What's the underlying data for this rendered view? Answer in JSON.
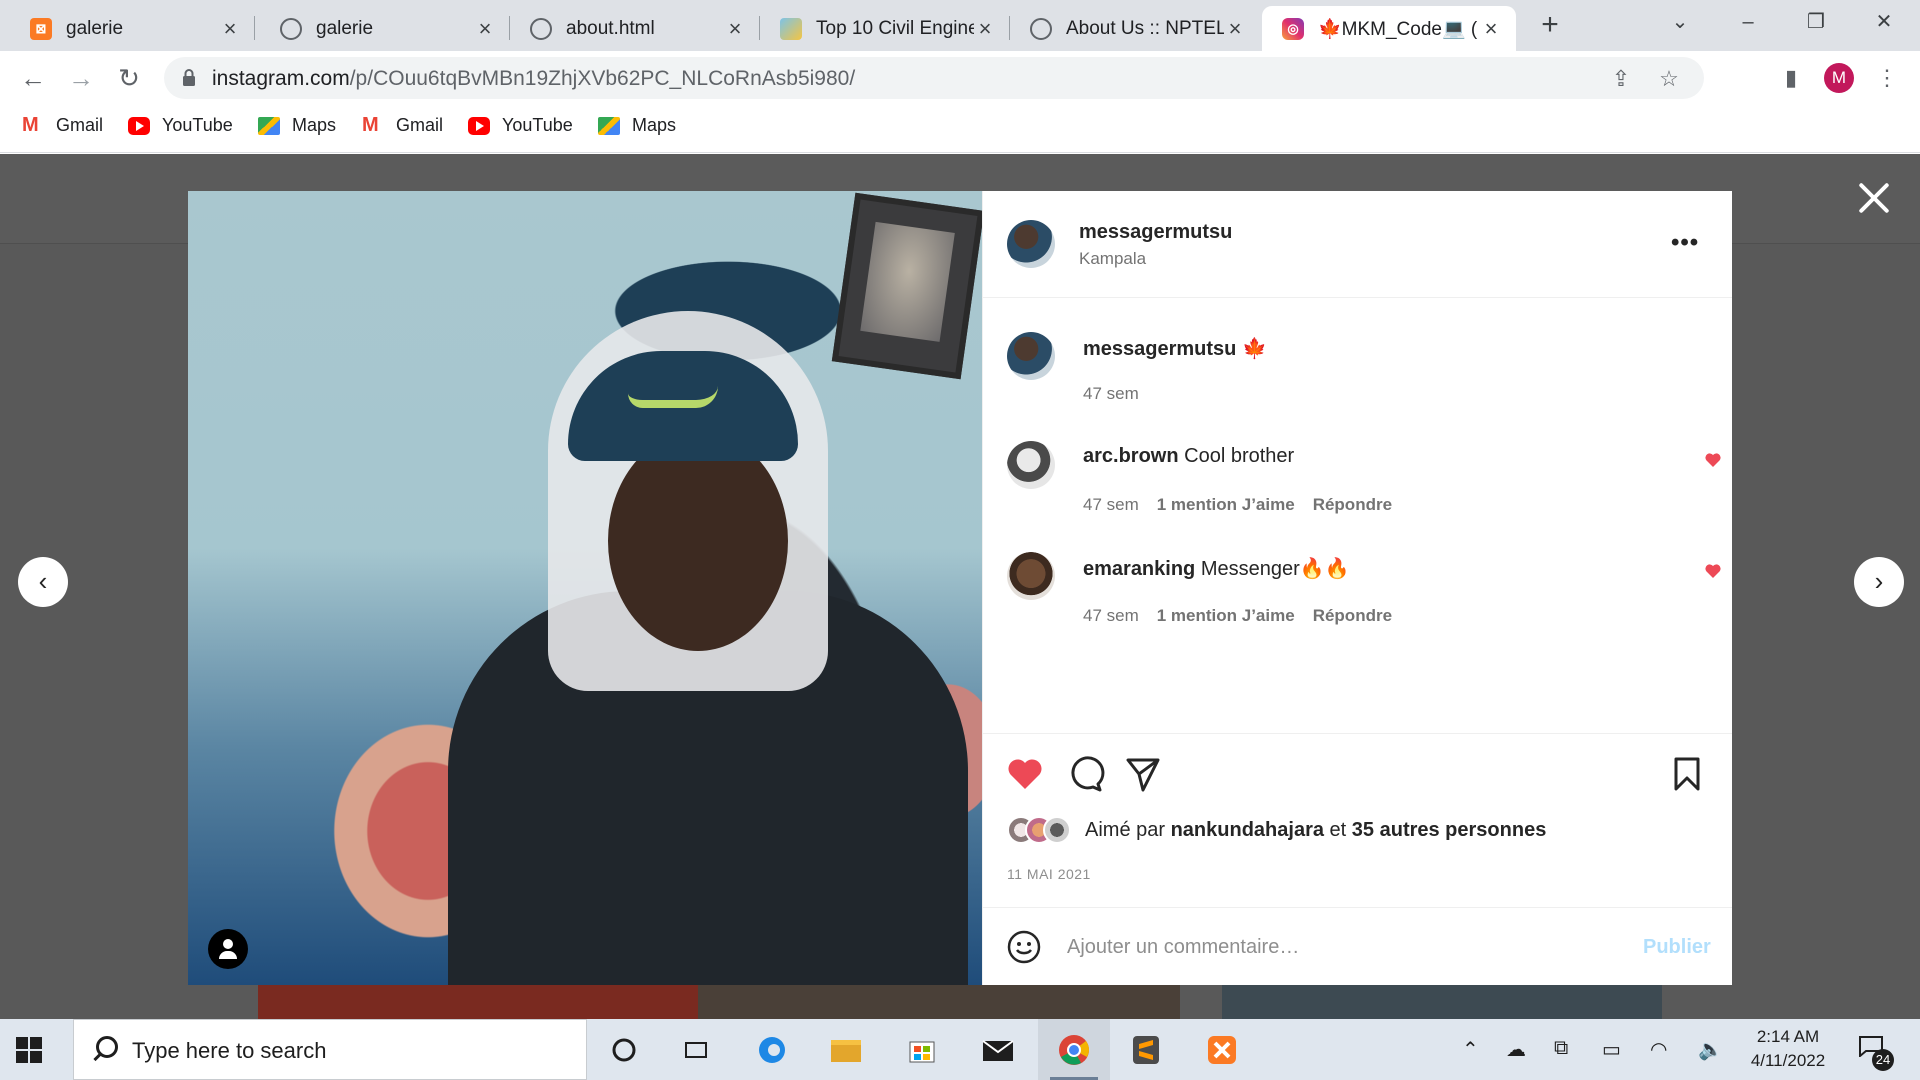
{
  "browser": {
    "tabs": [
      {
        "title": "galerie",
        "icon": "xampp-icon"
      },
      {
        "title": "galerie",
        "icon": "globe-icon"
      },
      {
        "title": "about.html",
        "icon": "globe-icon"
      },
      {
        "title": "Top 10 Civil Engine",
        "icon": "chart-icon"
      },
      {
        "title": "About Us :: NPTEL",
        "icon": "globe-icon"
      },
      {
        "title": "🍁MKM_Code💻 (",
        "icon": "instagram-icon",
        "active": true
      }
    ],
    "url_main": "instagram.com",
    "url_path": "/p/COuu6tqBvMBn19ZhjXVb62PC_NLCoRnAsb5i980/",
    "profile_initial": "M",
    "bookmarks": [
      {
        "label": "Gmail",
        "icon": "gmail-icon"
      },
      {
        "label": "YouTube",
        "icon": "youtube-icon"
      },
      {
        "label": "Maps",
        "icon": "maps-icon"
      },
      {
        "label": "Gmail",
        "icon": "gmail-icon"
      },
      {
        "label": "YouTube",
        "icon": "youtube-icon"
      },
      {
        "label": "Maps",
        "icon": "maps-icon"
      }
    ]
  },
  "post": {
    "author": "messagermutsu",
    "location": "Kampala",
    "caption_author": "messagermutsu",
    "caption_emoji": "🍁",
    "caption_time": "47 sem",
    "comments": [
      {
        "user": "arc.brown",
        "text": "Cool brother",
        "time": "47 sem",
        "likes": "1 mention J’aime",
        "reply": "Répondre"
      },
      {
        "user": "emaranking",
        "text": "Messenger🔥🔥",
        "time": "47 sem",
        "likes": "1 mention J’aime",
        "reply": "Répondre"
      }
    ],
    "liked_by_prefix": "Aimé par",
    "liked_by_user": "nankundahajara",
    "liked_by_joiner": "et",
    "liked_by_others": "35 autres personnes",
    "date": "11 MAI 2021",
    "comment_placeholder": "Ajouter un commentaire…",
    "publish_label": "Publier"
  },
  "colors": {
    "like_red": "#ed4956",
    "publish_disabled": "#b2dffc",
    "backdrop": "#595959"
  },
  "taskbar": {
    "search_placeholder": "Type here to search",
    "time": "2:14 AM",
    "date": "4/11/2022",
    "notification_count": "24"
  }
}
